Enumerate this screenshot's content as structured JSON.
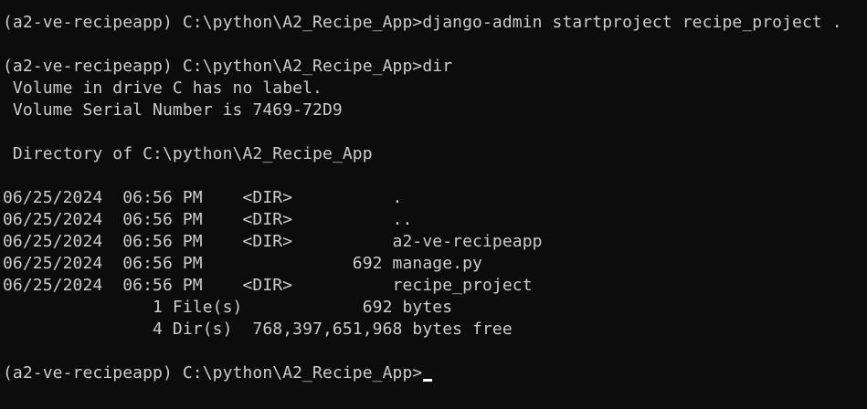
{
  "terminal": {
    "lines": [
      "(a2-ve-recipeapp) C:\\python\\A2_Recipe_App>django-admin startproject recipe_project .",
      "",
      "(a2-ve-recipeapp) C:\\python\\A2_Recipe_App>dir",
      " Volume in drive C has no label.",
      " Volume Serial Number is 7469-72D9",
      "",
      " Directory of C:\\python\\A2_Recipe_App",
      "",
      "06/25/2024  06:56 PM    <DIR>          .",
      "06/25/2024  06:56 PM    <DIR>          ..",
      "06/25/2024  06:56 PM    <DIR>          a2-ve-recipeapp",
      "06/25/2024  06:56 PM               692 manage.py",
      "06/25/2024  06:56 PM    <DIR>          recipe_project",
      "               1 File(s)            692 bytes",
      "               4 Dir(s)  768,397,651,968 bytes free",
      "",
      "(a2-ve-recipeapp) C:\\python\\A2_Recipe_App>"
    ]
  },
  "colors": {
    "background": "#0c0c0c",
    "text": "#cccccc",
    "cursor": "#ffffff"
  }
}
